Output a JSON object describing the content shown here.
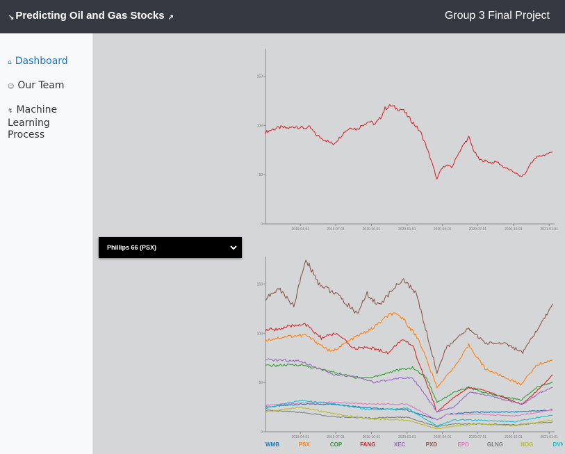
{
  "header": {
    "title": "Predicting Oil and Gas Stocks",
    "project": "Group 3 Final Project",
    "left_icon": "chart-down-icon",
    "right_icon": "chart-up-icon"
  },
  "sidebar": {
    "items": [
      {
        "label": "Dashboard",
        "icon": "home-icon",
        "active": true
      },
      {
        "label": "Our Team",
        "icon": "users-icon",
        "active": false
      },
      {
        "label": "Machine Learning Process",
        "icon": "bolt-icon",
        "active": false
      }
    ]
  },
  "selector": {
    "selected": "Phillips 66 (PSX)"
  },
  "chart_data": [
    {
      "type": "line",
      "title": "",
      "x_ticks": [
        "2019-04-01",
        "2019-07-01",
        "2019-10-01",
        "2020-01-01",
        "2020-04-01",
        "2020-07-01",
        "2020-10-01",
        "2021-01-01"
      ],
      "y_ticks": [
        0,
        50,
        100,
        150
      ],
      "ylim": [
        0,
        175
      ],
      "x_range": [
        "2019-01-01",
        "2021-01-15"
      ],
      "series": [
        {
          "color": "#d62728",
          "points": [
            [
              "2019-01-01",
              93
            ],
            [
              "2019-01-20",
              96
            ],
            [
              "2019-02-10",
              98
            ],
            [
              "2019-03-01",
              97
            ],
            [
              "2019-03-20",
              99
            ],
            [
              "2019-04-10",
              97
            ],
            [
              "2019-04-25",
              98
            ],
            [
              "2019-05-10",
              91
            ],
            [
              "2019-05-25",
              87
            ],
            [
              "2019-06-10",
              84
            ],
            [
              "2019-06-25",
              81
            ],
            [
              "2019-07-10",
              87
            ],
            [
              "2019-07-25",
              94
            ],
            [
              "2019-08-10",
              98
            ],
            [
              "2019-08-25",
              96
            ],
            [
              "2019-09-10",
              101
            ],
            [
              "2019-09-25",
              104
            ],
            [
              "2019-10-10",
              101
            ],
            [
              "2019-10-25",
              108
            ],
            [
              "2019-11-05",
              117
            ],
            [
              "2019-11-20",
              120
            ],
            [
              "2019-12-05",
              117
            ],
            [
              "2019-12-20",
              116
            ],
            [
              "2020-01-05",
              108
            ],
            [
              "2020-01-20",
              101
            ],
            [
              "2020-02-05",
              93
            ],
            [
              "2020-02-20",
              78
            ],
            [
              "2020-03-05",
              62
            ],
            [
              "2020-03-18",
              45
            ],
            [
              "2020-03-28",
              55
            ],
            [
              "2020-04-10",
              60
            ],
            [
              "2020-04-25",
              57
            ],
            [
              "2020-05-10",
              70
            ],
            [
              "2020-05-25",
              80
            ],
            [
              "2020-06-08",
              88
            ],
            [
              "2020-06-20",
              75
            ],
            [
              "2020-07-05",
              65
            ],
            [
              "2020-07-20",
              64
            ],
            [
              "2020-08-05",
              62
            ],
            [
              "2020-08-20",
              63
            ],
            [
              "2020-09-05",
              58
            ],
            [
              "2020-09-20",
              55
            ],
            [
              "2020-10-05",
              52
            ],
            [
              "2020-10-20",
              48
            ],
            [
              "2020-11-01",
              51
            ],
            [
              "2020-11-15",
              62
            ],
            [
              "2020-12-01",
              68
            ],
            [
              "2020-12-20",
              70
            ],
            [
              "2021-01-10",
              73
            ]
          ]
        }
      ]
    },
    {
      "type": "line",
      "title": "",
      "x_ticks": [
        "2019-04-01",
        "2019-07-01",
        "2019-10-01",
        "2020-01-01",
        "2020-04-01",
        "2020-07-01",
        "2020-10-01",
        "2021-01-01"
      ],
      "y_ticks": [
        0,
        50,
        100,
        150
      ],
      "ylim": [
        0,
        175
      ],
      "x_range": [
        "2019-01-01",
        "2021-01-15"
      ],
      "legend_position": "bottom",
      "series": [
        {
          "name": "WMB",
          "color": "#1f77b4",
          "points": [
            [
              "2019-01-01",
              25
            ],
            [
              "2019-04-01",
              28
            ],
            [
              "2019-07-01",
              28
            ],
            [
              "2019-10-01",
              24
            ],
            [
              "2020-01-01",
              22
            ],
            [
              "2020-03-18",
              12
            ],
            [
              "2020-04-15",
              18
            ],
            [
              "2020-07-01",
              20
            ],
            [
              "2020-10-01",
              20
            ],
            [
              "2021-01-10",
              22
            ]
          ]
        },
        {
          "name": "PSX",
          "color": "#ff7f0e",
          "points": [
            [
              "2019-01-01",
              93
            ],
            [
              "2019-03-01",
              97
            ],
            [
              "2019-04-15",
              98
            ],
            [
              "2019-06-20",
              81
            ],
            [
              "2019-08-20",
              96
            ],
            [
              "2019-10-01",
              104
            ],
            [
              "2019-11-20",
              120
            ],
            [
              "2019-12-20",
              116
            ],
            [
              "2020-02-01",
              93
            ],
            [
              "2020-03-18",
              45
            ],
            [
              "2020-05-10",
              70
            ],
            [
              "2020-06-08",
              88
            ],
            [
              "2020-07-20",
              64
            ],
            [
              "2020-10-20",
              48
            ],
            [
              "2020-12-01",
              68
            ],
            [
              "2021-01-10",
              73
            ]
          ]
        },
        {
          "name": "COP",
          "color": "#2ca02c",
          "points": [
            [
              "2019-01-01",
              67
            ],
            [
              "2019-04-01",
              68
            ],
            [
              "2019-07-01",
              60
            ],
            [
              "2019-08-20",
              55
            ],
            [
              "2019-10-01",
              55
            ],
            [
              "2019-12-01",
              62
            ],
            [
              "2020-01-15",
              65
            ],
            [
              "2020-02-20",
              55
            ],
            [
              "2020-03-18",
              30
            ],
            [
              "2020-05-01",
              40
            ],
            [
              "2020-06-08",
              45
            ],
            [
              "2020-07-15",
              40
            ],
            [
              "2020-10-20",
              32
            ],
            [
              "2020-12-01",
              45
            ],
            [
              "2021-01-10",
              50
            ]
          ]
        },
        {
          "name": "FANG",
          "color": "#d62728",
          "points": [
            [
              "2019-01-01",
              103
            ],
            [
              "2019-02-15",
              105
            ],
            [
              "2019-04-10",
              110
            ],
            [
              "2019-05-25",
              95
            ],
            [
              "2019-07-01",
              100
            ],
            [
              "2019-08-15",
              85
            ],
            [
              "2019-10-01",
              85
            ],
            [
              "2019-11-15",
              80
            ],
            [
              "2019-12-15",
              93
            ],
            [
              "2020-01-15",
              88
            ],
            [
              "2020-03-18",
              20
            ],
            [
              "2020-05-01",
              35
            ],
            [
              "2020-06-08",
              45
            ],
            [
              "2020-07-15",
              42
            ],
            [
              "2020-10-25",
              28
            ],
            [
              "2020-12-10",
              45
            ],
            [
              "2021-01-10",
              58
            ]
          ]
        },
        {
          "name": "XEC",
          "color": "#9467bd",
          "points": [
            [
              "2019-01-01",
              73
            ],
            [
              "2019-04-01",
              72
            ],
            [
              "2019-06-25",
              58
            ],
            [
              "2019-09-01",
              55
            ],
            [
              "2019-10-10",
              50
            ],
            [
              "2019-12-15",
              55
            ],
            [
              "2020-01-15",
              55
            ],
            [
              "2020-03-18",
              20
            ],
            [
              "2020-05-01",
              25
            ],
            [
              "2020-06-10",
              40
            ],
            [
              "2020-07-15",
              38
            ],
            [
              "2020-10-25",
              28
            ],
            [
              "2020-12-10",
              40
            ],
            [
              "2021-01-10",
              45
            ]
          ]
        },
        {
          "name": "PXD",
          "color": "#8c564b",
          "points": [
            [
              "2019-01-01",
              135
            ],
            [
              "2019-02-05",
              145
            ],
            [
              "2019-03-15",
              128
            ],
            [
              "2019-04-15",
              175
            ],
            [
              "2019-05-20",
              150
            ],
            [
              "2019-07-01",
              140
            ],
            [
              "2019-08-25",
              120
            ],
            [
              "2019-09-20",
              140
            ],
            [
              "2019-10-20",
              128
            ],
            [
              "2019-12-20",
              155
            ],
            [
              "2020-01-25",
              140
            ],
            [
              "2020-03-18",
              60
            ],
            [
              "2020-04-10",
              85
            ],
            [
              "2020-06-08",
              105
            ],
            [
              "2020-07-20",
              90
            ],
            [
              "2020-09-10",
              90
            ],
            [
              "2020-10-25",
              80
            ],
            [
              "2020-12-15",
              112
            ],
            [
              "2021-01-10",
              130
            ]
          ]
        },
        {
          "name": "EPD",
          "color": "#e377c2",
          "points": [
            [
              "2019-01-01",
              27
            ],
            [
              "2019-04-01",
              29
            ],
            [
              "2019-07-01",
              30
            ],
            [
              "2019-10-01",
              28
            ],
            [
              "2020-01-01",
              28
            ],
            [
              "2020-03-18",
              12
            ],
            [
              "2020-04-15",
              18
            ],
            [
              "2020-07-01",
              18
            ],
            [
              "2020-10-01",
              16
            ],
            [
              "2021-01-10",
              22
            ]
          ]
        },
        {
          "name": "GLNG",
          "color": "#7f7f7f",
          "points": [
            [
              "2019-01-01",
              22
            ],
            [
              "2019-04-01",
              20
            ],
            [
              "2019-07-01",
              15
            ],
            [
              "2019-10-01",
              14
            ],
            [
              "2020-01-01",
              15
            ],
            [
              "2020-03-18",
              5
            ],
            [
              "2020-05-01",
              8
            ],
            [
              "2020-07-01",
              8
            ],
            [
              "2020-10-01",
              7
            ],
            [
              "2021-01-10",
              10
            ]
          ]
        },
        {
          "name": "NOG",
          "color": "#bcbd22",
          "points": [
            [
              "2019-01-01",
              20
            ],
            [
              "2019-04-01",
              25
            ],
            [
              "2019-07-01",
              18
            ],
            [
              "2019-10-01",
              13
            ],
            [
              "2020-01-01",
              12
            ],
            [
              "2020-03-18",
              3
            ],
            [
              "2020-05-01",
              6
            ],
            [
              "2020-07-01",
              8
            ],
            [
              "2020-10-01",
              6
            ],
            [
              "2021-01-10",
              12
            ]
          ]
        },
        {
          "name": "DVN",
          "color": "#17becf",
          "points": [
            [
              "2019-01-01",
              24
            ],
            [
              "2019-04-01",
              32
            ],
            [
              "2019-07-01",
              28
            ],
            [
              "2019-10-01",
              22
            ],
            [
              "2020-01-01",
              24
            ],
            [
              "2020-03-18",
              6
            ],
            [
              "2020-05-01",
              12
            ],
            [
              "2020-07-01",
              12
            ],
            [
              "2020-10-01",
              10
            ],
            [
              "2021-01-10",
              17
            ]
          ]
        }
      ]
    }
  ]
}
